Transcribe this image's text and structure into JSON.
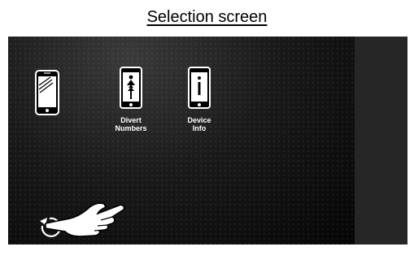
{
  "caption": "Selection screen",
  "tiles": [
    {
      "id": "phone",
      "icon": "smartphone-icon",
      "label": ""
    },
    {
      "id": "divert",
      "icon": "divert-person-icon",
      "label": "Divert\nNumbers"
    },
    {
      "id": "info",
      "icon": "info-icon",
      "label": "Device\nInfo"
    }
  ],
  "gesture": {
    "icon": "pointing-hand-icon",
    "back_icon": "back-arrow-icon"
  },
  "colors": {
    "screen_bg": "#121212",
    "side_panel": "#262626",
    "icon_outline": "#ffffff"
  }
}
